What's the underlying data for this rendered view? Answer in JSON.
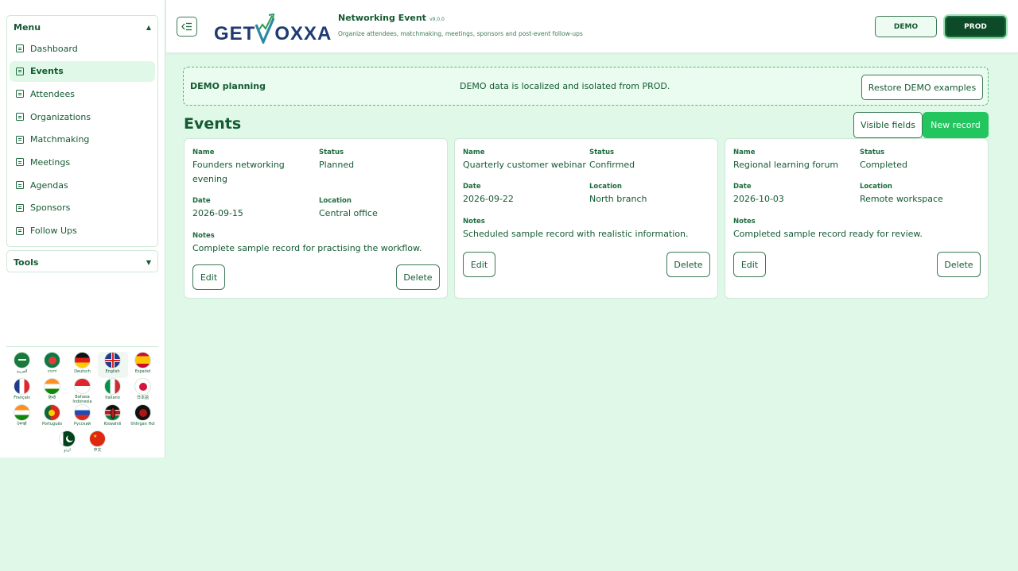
{
  "sidebar": {
    "menu_title": "Menu",
    "tools_title": "Tools",
    "items": [
      {
        "label": "Dashboard"
      },
      {
        "label": "Events"
      },
      {
        "label": "Attendees"
      },
      {
        "label": "Organizations"
      },
      {
        "label": "Matchmaking"
      },
      {
        "label": "Meetings"
      },
      {
        "label": "Agendas"
      },
      {
        "label": "Sponsors"
      },
      {
        "label": "Follow Ups"
      }
    ],
    "active_item": "Events",
    "languages": [
      {
        "name": "العربية",
        "icon": "saudi-flag-icon"
      },
      {
        "name": "বাংলা",
        "icon": "bangladesh-flag-icon"
      },
      {
        "name": "Deutsch",
        "icon": "germany-flag-icon"
      },
      {
        "name": "English",
        "icon": "uk-flag-icon"
      },
      {
        "name": "Español",
        "icon": "spain-flag-icon"
      },
      {
        "name": "Français",
        "icon": "france-flag-icon"
      },
      {
        "name": "हिन्दी",
        "icon": "india-flag-icon"
      },
      {
        "name": "Bahasa Indonesia",
        "icon": "indonesia-flag-icon"
      },
      {
        "name": "Italiano",
        "icon": "italy-flag-icon"
      },
      {
        "name": "日本語",
        "icon": "japan-flag-icon"
      },
      {
        "name": "ਪੰਜਾਬੀ",
        "icon": "india-flag-icon"
      },
      {
        "name": "Português",
        "icon": "portugal-flag-icon"
      },
      {
        "name": "Русский",
        "icon": "russia-flag-icon"
      },
      {
        "name": "Kiswahili",
        "icon": "kenya-flag-icon"
      },
      {
        "name": "tlhIngan Hol",
        "icon": "klingon-flag-icon"
      },
      {
        "name": "اردو",
        "icon": "pakistan-flag-icon"
      },
      {
        "name": "中文",
        "icon": "china-flag-icon"
      }
    ],
    "selected_language": "English"
  },
  "header": {
    "logo_text_left": "GET",
    "logo_text_right": "OXXA",
    "title": "Networking Event",
    "version": "v9.0.0",
    "subtitle": "Organize attendees, matchmaking, meetings, sponsors and post-event follow-ups",
    "demo_label": "DEMO",
    "prod_label": "PROD",
    "active_env": "PROD"
  },
  "banner": {
    "title": "DEMO planning",
    "message": "DEMO data is localized and isolated from PROD.",
    "restore_label": "Restore DEMO examples"
  },
  "events": {
    "title": "Events",
    "visible_fields_label": "Visible fields",
    "new_record_label": "New record",
    "labels": {
      "name": "Name",
      "status": "Status",
      "date": "Date",
      "location": "Location",
      "notes": "Notes"
    },
    "edit_label": "Edit",
    "delete_label": "Delete",
    "records": [
      {
        "name": "Founders networking evening",
        "status": "Planned",
        "date": "2026-09-15",
        "location": "Central office",
        "notes": "Complete sample record for practising the workflow."
      },
      {
        "name": "Quarterly customer webinar",
        "status": "Confirmed",
        "date": "2026-09-22",
        "location": "North branch",
        "notes": "Scheduled sample record with realistic information."
      },
      {
        "name": "Regional learning forum",
        "status": "Completed",
        "date": "2026-10-03",
        "location": "Remote workspace",
        "notes": "Completed sample record ready for review."
      }
    ]
  },
  "colors": {
    "background": "#e0f8e8",
    "primary_text": "#145a32",
    "accent_green": "#22c55e",
    "prod_dark": "#0d4a27",
    "logo_navy": "#1f3b73",
    "logo_teal": "#2a8aa3"
  }
}
